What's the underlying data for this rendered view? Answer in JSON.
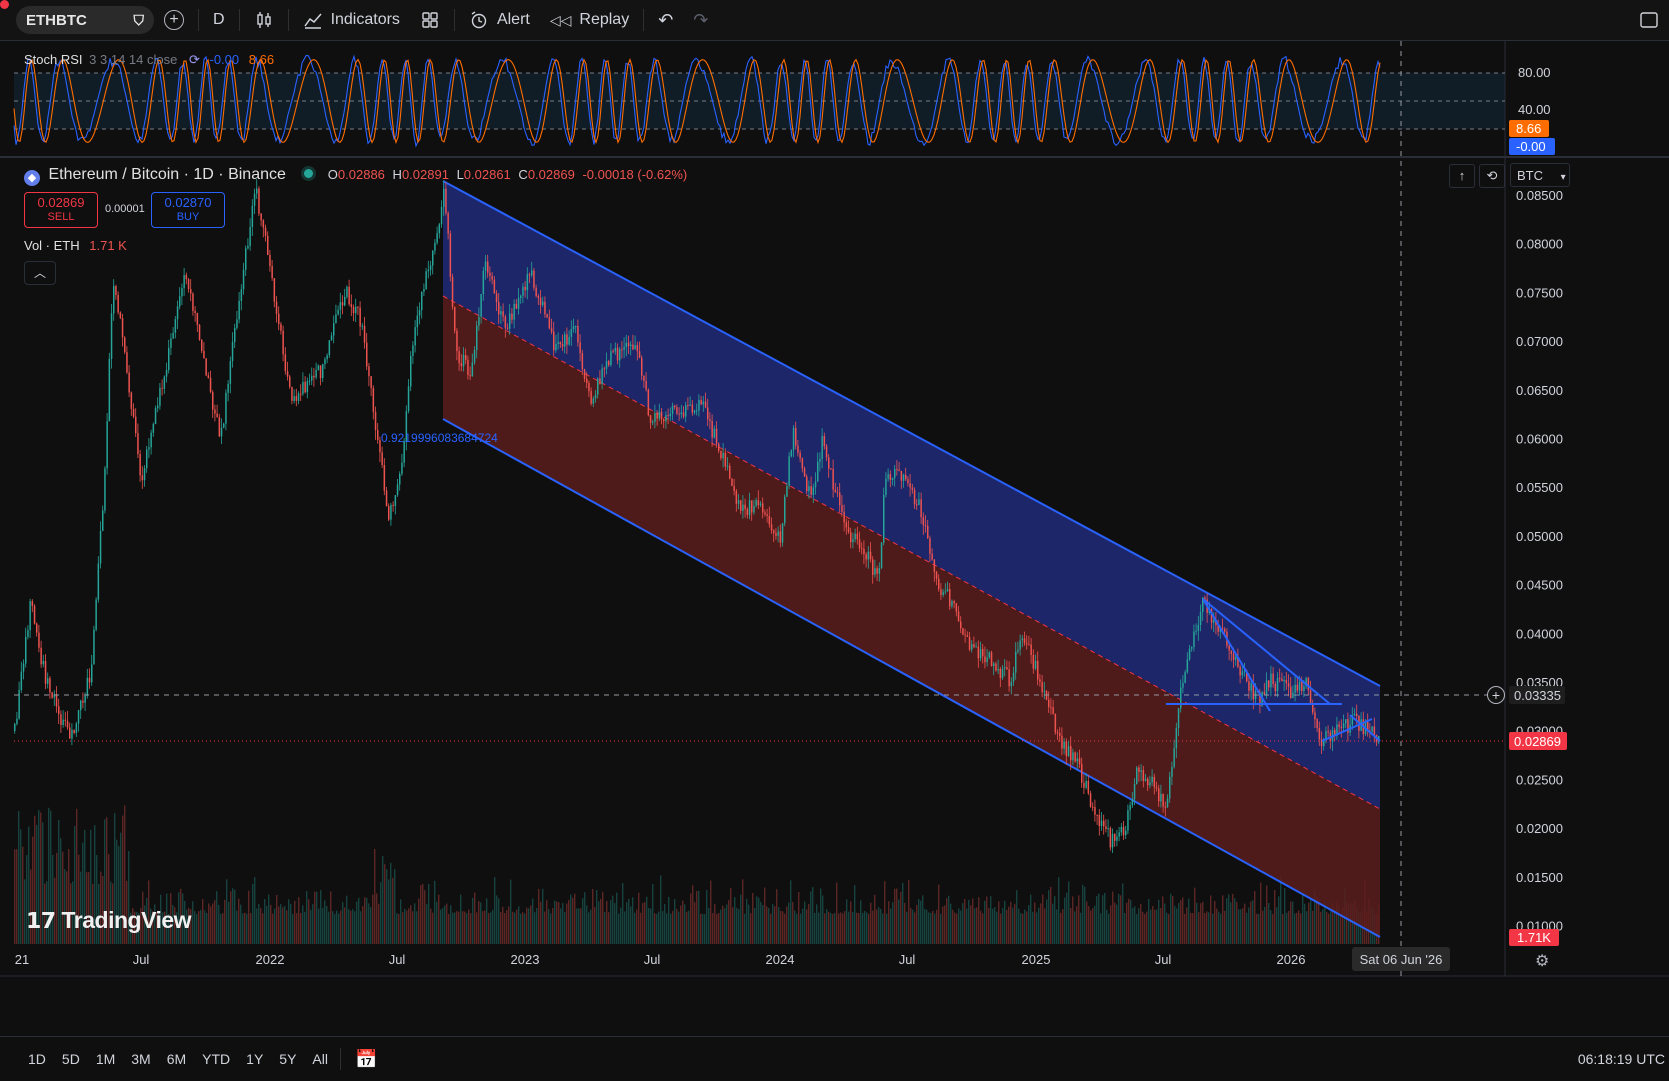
{
  "toolbar": {
    "symbol": "ETHBTC",
    "interval": "D",
    "indicators_label": "Indicators",
    "alert_label": "Alert",
    "replay_label": "Replay"
  },
  "indicator": {
    "name": "Stoch RSI",
    "params": "3 3 14 14 close",
    "value_k": "-0.00",
    "value_d": "8.66",
    "levels": [
      "80.00",
      "40.00"
    ],
    "tag_d": "8.66",
    "tag_k": "-0.00"
  },
  "main": {
    "title": "Ethereum / Bitcoin · 1D · Binance",
    "o_label": "O",
    "o_value": "0.02886",
    "h_label": "H",
    "h_value": "0.02891",
    "l_label": "L",
    "l_value": "0.02861",
    "c_label": "C",
    "c_value": "0.02869",
    "change": "-0.00018 (-0.62%)",
    "sell_price": "0.02869",
    "sell_label": "SELL",
    "spread": "0.00001",
    "buy_price": "0.02870",
    "buy_label": "BUY",
    "vol_label": "Vol · ETH",
    "vol_value": "1.71 K",
    "fib_label": "0.9219996083684724",
    "currency": "BTC"
  },
  "price_axis": {
    "ticks": [
      "0.08500",
      "0.08000",
      "0.07500",
      "0.07000",
      "0.06500",
      "0.06000",
      "0.05500",
      "0.05000",
      "0.04500",
      "0.04000",
      "0.03500",
      "0.03000",
      "0.02500",
      "0.02000",
      "0.01500",
      "0.01000"
    ],
    "crosshair_price": "0.03335",
    "last_price": "0.02869",
    "volume_tag": "1.71K"
  },
  "time_axis": {
    "ticks": [
      "21",
      "Jul",
      "2022",
      "Jul",
      "2023",
      "Jul",
      "2024",
      "Jul",
      "2025",
      "Jul",
      "2026"
    ],
    "crosshair_date": "Sat 06 Jun '26"
  },
  "bottom": {
    "ranges": [
      "1D",
      "5D",
      "1M",
      "3M",
      "6M",
      "YTD",
      "1Y",
      "5Y",
      "All"
    ],
    "clock": "06:18:19 UTC"
  },
  "watermark": "TradingView",
  "colors": {
    "up": "#26a69a",
    "down": "#ef5350",
    "accent": "#2962ff",
    "stoch_k": "#2962ff",
    "stoch_d": "#ff6d00",
    "channel_upper": "#1e2a78",
    "channel_lower": "#5a1c1c"
  }
}
